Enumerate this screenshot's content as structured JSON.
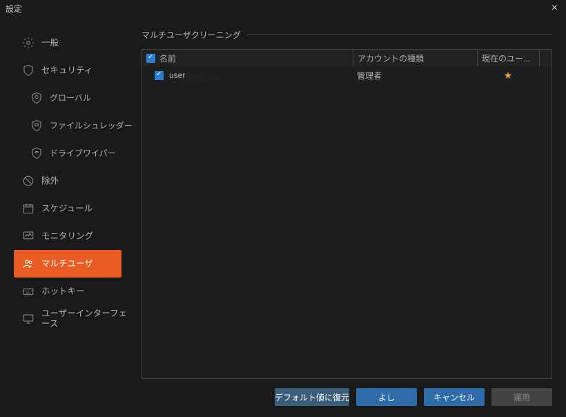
{
  "window": {
    "title": "設定"
  },
  "sidebar": {
    "items": [
      {
        "label": "一般"
      },
      {
        "label": "セキュリティ"
      },
      {
        "label": "グローバル"
      },
      {
        "label": "ファイルシュレッダー"
      },
      {
        "label": "ドライブワイパー"
      },
      {
        "label": "除外"
      },
      {
        "label": "スケジュール"
      },
      {
        "label": "モニタリング"
      },
      {
        "label": "マルチユーザ"
      },
      {
        "label": "ホットキー"
      },
      {
        "label": "ユーザーインターフェース"
      }
    ]
  },
  "section": {
    "title": "マルチユーザクリーニング"
  },
  "table": {
    "headers": {
      "name": "名前",
      "type": "アカウントの種類",
      "current": "現在のユー..."
    },
    "rows": [
      {
        "name": "user",
        "type": "管理者",
        "current": true,
        "checked": true
      }
    ]
  },
  "buttons": {
    "restore": "デフォルト値に復元",
    "ok": "よし",
    "cancel": "キャンセル",
    "apply": "運用"
  }
}
